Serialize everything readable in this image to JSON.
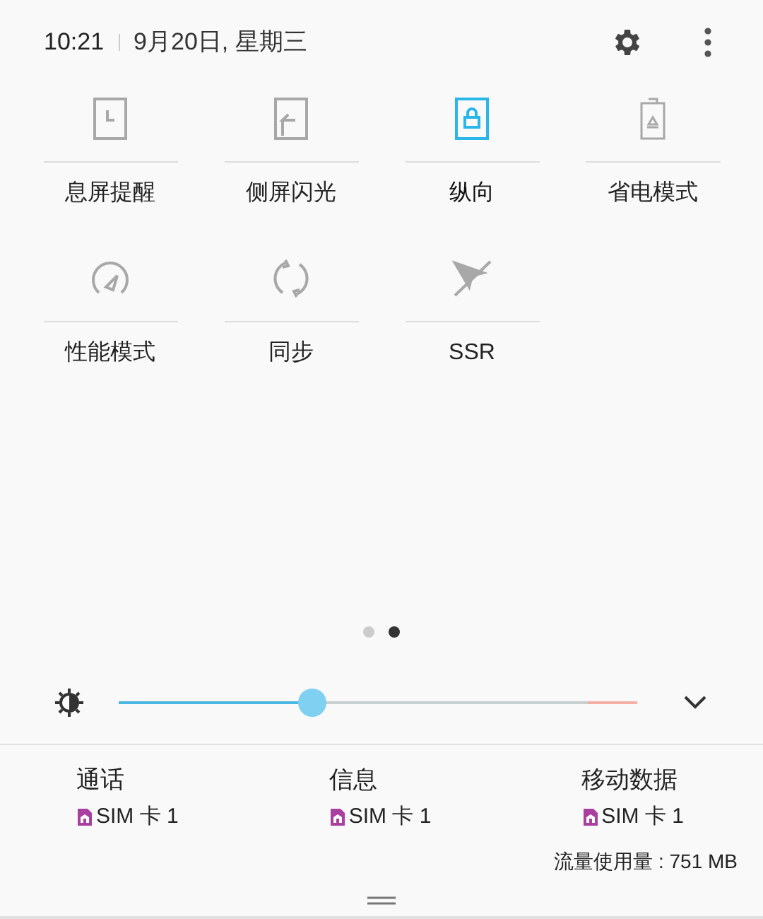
{
  "header": {
    "time": "10:21",
    "date": "9月20日, 星期三"
  },
  "tiles": [
    {
      "kind": "aod",
      "label": "息屏提醒",
      "on": false
    },
    {
      "kind": "edge",
      "label": "侧屏闪光",
      "on": false
    },
    {
      "kind": "portrait",
      "label": "纵向",
      "on": true
    },
    {
      "kind": "power",
      "label": "省电模式",
      "on": false
    },
    {
      "kind": "performance",
      "label": "性能模式",
      "on": false
    },
    {
      "kind": "sync",
      "label": "同步",
      "on": false
    },
    {
      "kind": "ssr",
      "label": "SSR",
      "on": false
    }
  ],
  "pages": [
    {
      "selected": false
    },
    {
      "selected": true
    }
  ],
  "brightness": {
    "level": 0.373
  },
  "sim": [
    {
      "label": "通话",
      "card": "SIM 卡 1"
    },
    {
      "label": "信息",
      "card": "SIM 卡 1"
    },
    {
      "label": "移动数据",
      "card": "SIM 卡 1"
    }
  ],
  "usage": "流量使用量 : 751 MB"
}
